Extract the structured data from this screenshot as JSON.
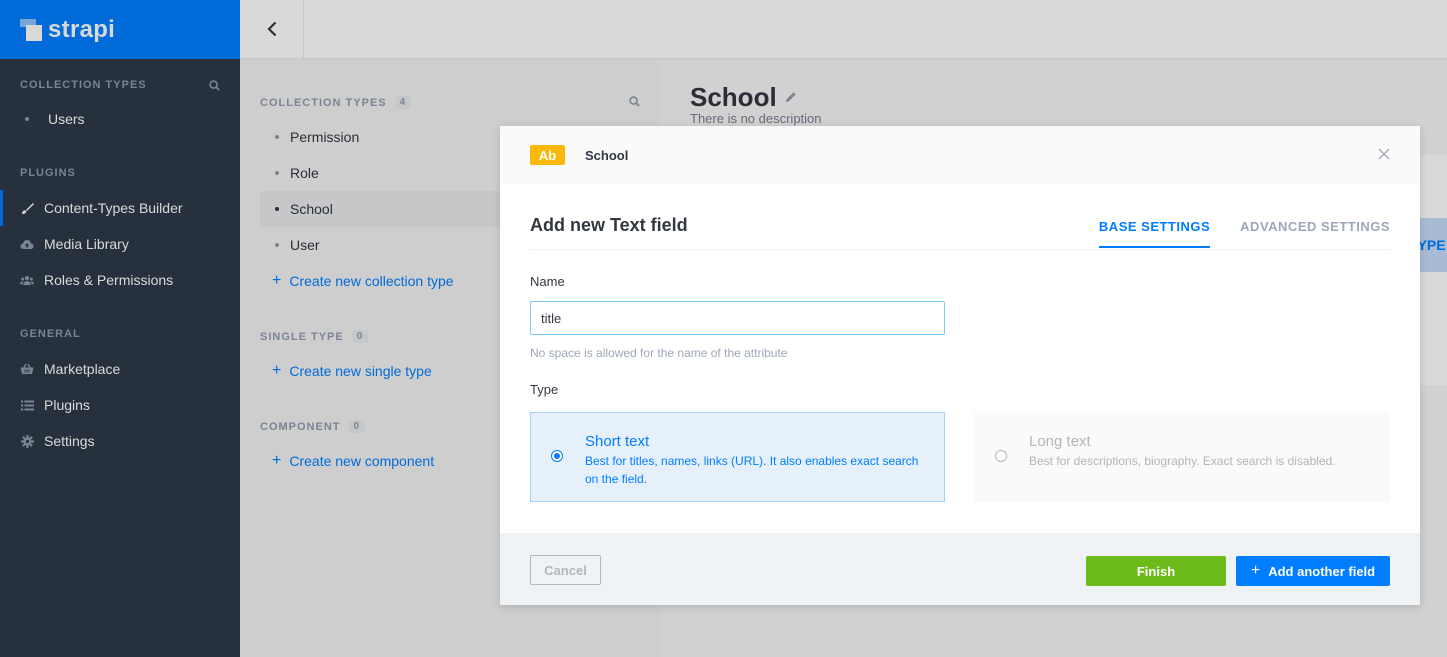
{
  "brand": {
    "name": "strapi"
  },
  "sidebar": {
    "collection_heading": "COLLECTION TYPES",
    "collection_items": [
      {
        "label": "Users"
      }
    ],
    "plugins_heading": "PLUGINS",
    "plugins_items": [
      {
        "label": "Content-Types Builder",
        "icon": "brush-icon",
        "active": true
      },
      {
        "label": "Media Library",
        "icon": "cloud-upload-icon"
      },
      {
        "label": "Roles & Permissions",
        "icon": "users-icon"
      }
    ],
    "general_heading": "GENERAL",
    "general_items": [
      {
        "label": "Marketplace",
        "icon": "basket-icon"
      },
      {
        "label": "Plugins",
        "icon": "list-icon"
      },
      {
        "label": "Settings",
        "icon": "gear-icon"
      }
    ]
  },
  "ctb": {
    "collection_heading": "COLLECTION TYPES",
    "collection_count": "4",
    "collection_items": [
      "Permission",
      "Role",
      "School",
      "User"
    ],
    "selected": "School",
    "create_collection": "Create new collection type",
    "single_heading": "SINGLE TYPE",
    "single_count": "0",
    "create_single": "Create new single type",
    "component_heading": "COMPONENT",
    "component_count": "0",
    "create_component": "Create new component"
  },
  "main": {
    "title": "School",
    "description": "There is no description",
    "strip_text": "TYPE"
  },
  "modal": {
    "badge": "Ab",
    "header_name": "School",
    "title": "Add new Text field",
    "tabs": [
      "BASE SETTINGS",
      "ADVANCED SETTINGS"
    ],
    "name_label": "Name",
    "name_value": "title",
    "name_hint": "No space is allowed for the name of the attribute",
    "type_label": "Type",
    "short_text": {
      "title": "Short text",
      "description": "Best for titles, names, links (URL). It also enables exact search on the field.",
      "selected": true
    },
    "long_text": {
      "title": "Long text",
      "description": "Best for descriptions, biography. Exact search is disabled."
    },
    "cancel": "Cancel",
    "finish": "Finish",
    "add_another": "Add another field"
  },
  "colors": {
    "brand_blue": "#007eff",
    "sidebar_bg": "#2e3a48",
    "finish_green": "#6dbb1a",
    "badge_yellow": "#fab908"
  }
}
